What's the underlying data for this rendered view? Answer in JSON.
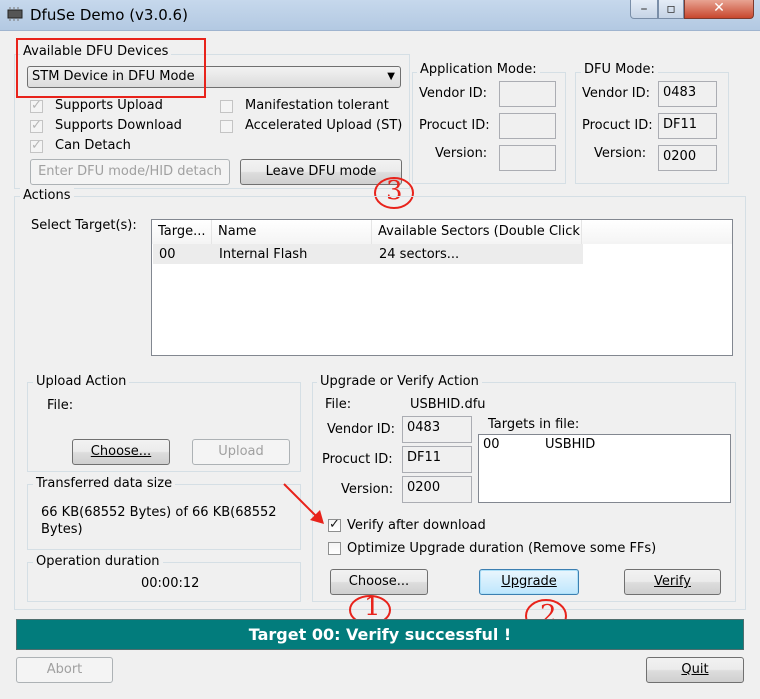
{
  "window": {
    "title": "DfuSe Demo (v3.0.6)"
  },
  "devices": {
    "group_label": "Available DFU Devices",
    "selected": "STM Device in DFU Mode",
    "checks": [
      {
        "label": "Supports Upload",
        "checked": true
      },
      {
        "label": "Supports Download",
        "checked": true
      },
      {
        "label": "Can Detach",
        "checked": true
      },
      {
        "label": "Manifestation tolerant",
        "checked": false
      },
      {
        "label": "Accelerated Upload (ST)",
        "checked": false
      }
    ],
    "enter_dfu_label": "Enter DFU mode/HID detach",
    "leave_dfu_label": "Leave DFU mode"
  },
  "app_mode": {
    "label": "Application Mode:",
    "vendor_label": "Vendor ID:",
    "product_label": "Procuct ID:",
    "version_label": "Version:",
    "vendor": "",
    "product": "",
    "version": ""
  },
  "dfu_mode": {
    "label": "DFU Mode:",
    "vendor_label": "Vendor ID:",
    "product_label": "Procuct ID:",
    "version_label": "Version:",
    "vendor": "0483",
    "product": "DF11",
    "version": "0200"
  },
  "actions": {
    "label": "Actions",
    "select_targets_label": "Select Target(s):",
    "columns": [
      "Targe...",
      "Name",
      "Available Sectors (Double Click..."
    ],
    "rows": [
      {
        "target": "00",
        "name": "Internal Flash",
        "sectors": "24 sectors..."
      }
    ]
  },
  "upload": {
    "label": "Upload Action",
    "file_label": "File:",
    "choose_label": "Choose...",
    "upload_label": "Upload"
  },
  "transferred": {
    "label": "Transferred data size",
    "value": "66 KB(68552 Bytes) of 66 KB(68552 Bytes)"
  },
  "duration": {
    "label": "Operation duration",
    "value": "00:00:12"
  },
  "upgrade": {
    "label": "Upgrade or Verify Action",
    "file_label": "File:",
    "file": "USBHID.dfu",
    "vendor_label": "Vendor ID:",
    "product_label": "Procuct ID:",
    "version_label": "Version:",
    "vendor": "0483",
    "product": "DF11",
    "version": "0200",
    "targets_label": "Targets in file:",
    "targets": [
      {
        "id": "00",
        "name": "USBHID"
      }
    ],
    "verify_after_label": "Verify after download",
    "verify_after_checked": true,
    "optimize_label": "Optimize Upgrade duration (Remove some FFs)",
    "optimize_checked": false,
    "choose_label": "Choose...",
    "upgrade_label": "Upgrade",
    "verify_label": "Verify"
  },
  "status": {
    "text": "Target 00: Verify successful !",
    "color": "#027c7c"
  },
  "footer": {
    "abort_label": "Abort",
    "quit_label": "Quit"
  },
  "annotations": {
    "mark1": "1",
    "mark2": "2",
    "mark3": "3",
    "highlight_color": "#e8231b"
  }
}
